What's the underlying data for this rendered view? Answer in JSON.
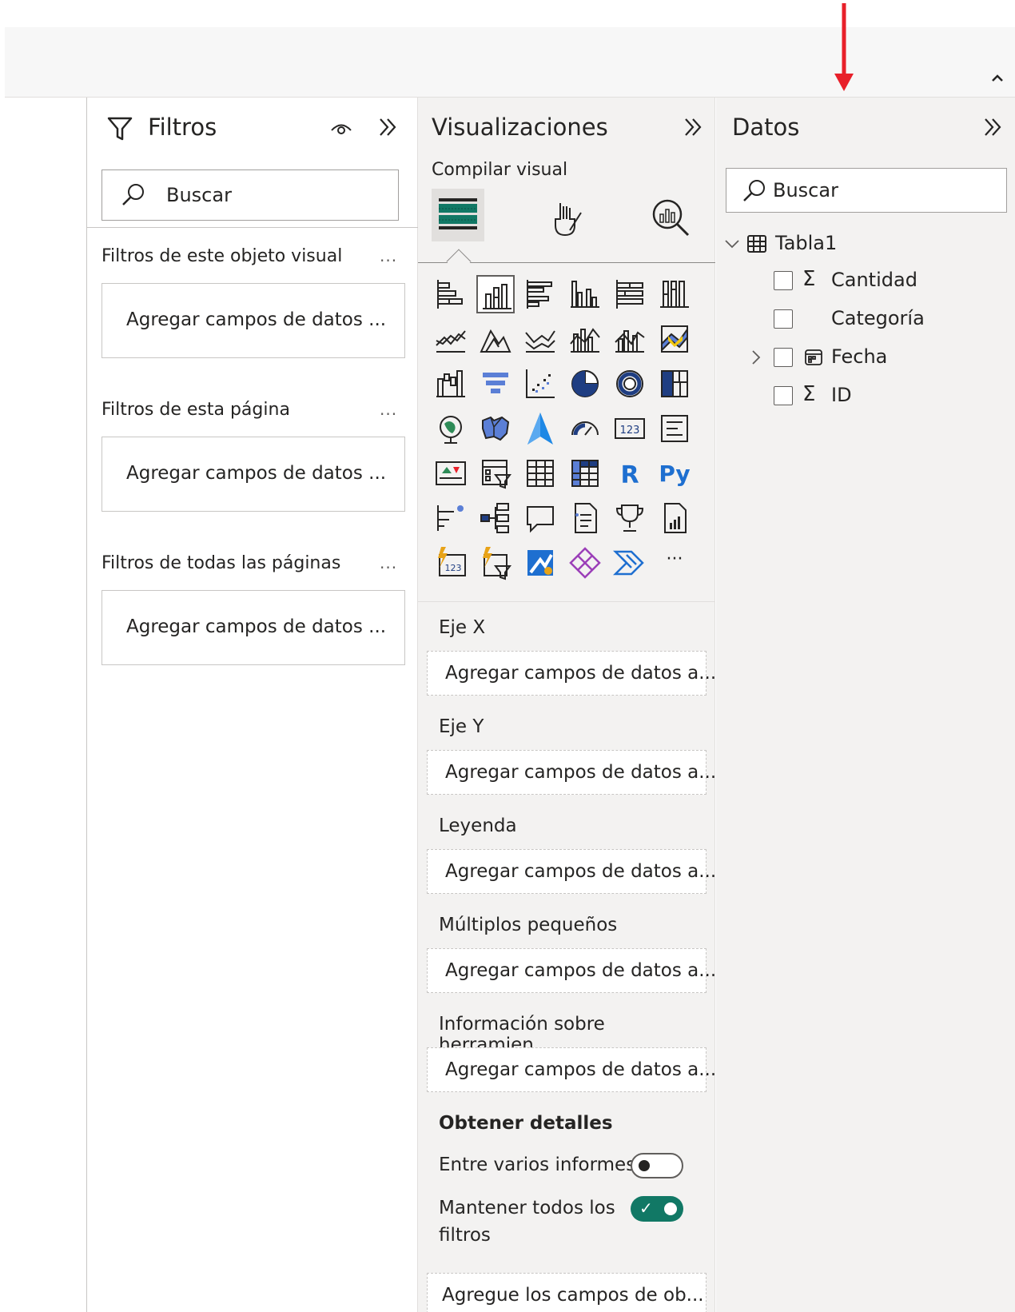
{
  "filters": {
    "title": "Filtros",
    "search_placeholder": "Buscar",
    "sections": [
      {
        "label": "Filtros de este objeto visual",
        "more": "...",
        "drop": "Agregar campos de datos ..."
      },
      {
        "label": "Filtros de esta página",
        "more": "...",
        "drop": "Agregar campos de datos ..."
      },
      {
        "label": "Filtros de todas las páginas",
        "more": "...",
        "drop": "Agregar campos de datos ..."
      }
    ]
  },
  "visualizations": {
    "title": "Visualizaciones",
    "subtitle": "Compilar visual",
    "tabs": [
      "build-visual-icon",
      "format-visual-icon",
      "analytics-icon"
    ],
    "gallery": [
      "stacked-bar-chart-icon",
      "stacked-column-chart-icon",
      "clustered-bar-chart-icon",
      "clustered-column-chart-icon",
      "100-stacked-bar-chart-icon",
      "100-stacked-column-chart-icon",
      "line-chart-icon",
      "area-chart-icon",
      "stacked-area-chart-icon",
      "line-stacked-column-chart-icon",
      "line-clustered-column-chart-icon",
      "ribbon-chart-icon",
      "waterfall-chart-icon",
      "funnel-icon",
      "scatter-chart-icon",
      "pie-chart-icon",
      "donut-chart-icon",
      "treemap-icon",
      "map-icon",
      "filled-map-icon",
      "azure-map-icon",
      "gauge-icon",
      "card-icon",
      "multi-row-card-icon",
      "kpi-icon",
      "slicer-icon",
      "table-icon",
      "matrix-icon",
      "r-visual-icon",
      "python-visual-icon",
      "key-influencers-icon",
      "decomposition-tree-icon",
      "qa-icon",
      "narrative-icon",
      "goals-icon",
      "paginated-report-icon",
      "power-apps-card-icon",
      "power-apps-slicer-icon",
      "power-automate-icon",
      "power-apps-icon",
      "power-automate-flow-icon",
      "more-visuals-icon"
    ],
    "gallery_text": {
      "r": "R",
      "py": "Py",
      "more": "···"
    },
    "wells": [
      {
        "label": "Eje X",
        "drop": "Agregar campos de datos a..."
      },
      {
        "label": "Eje Y",
        "drop": "Agregar campos de datos a..."
      },
      {
        "label": "Leyenda",
        "drop": "Agregar campos de datos a..."
      },
      {
        "label": "Múltiplos pequeños",
        "drop": "Agregar campos de datos a..."
      },
      {
        "label": "Información sobre herramien...",
        "drop": "Agregar campos de datos a..."
      }
    ],
    "drillthrough": {
      "title": "Obtener detalles",
      "cross_report_label": "Entre varios informes",
      "cross_report_on": false,
      "keep_filters_label_1": "Mantener todos los",
      "keep_filters_label_2": "filtros",
      "keep_filters_on": true,
      "drop": "Agregue los campos de ob..."
    }
  },
  "data": {
    "title": "Datos",
    "search_placeholder": "Buscar",
    "table": {
      "name": "Tabla1",
      "fields": [
        {
          "name": "Cantidad",
          "icon": "sigma-icon",
          "symbol": "Σ"
        },
        {
          "name": "Categoría",
          "icon": "",
          "symbol": ""
        },
        {
          "name": "Fecha",
          "icon": "calendar-icon",
          "symbol": ""
        },
        {
          "name": "ID",
          "icon": "sigma-icon",
          "symbol": "Σ"
        }
      ]
    }
  },
  "colors": {
    "accent_toggle": "#117865",
    "annotation_arrow": "#e8202a"
  }
}
